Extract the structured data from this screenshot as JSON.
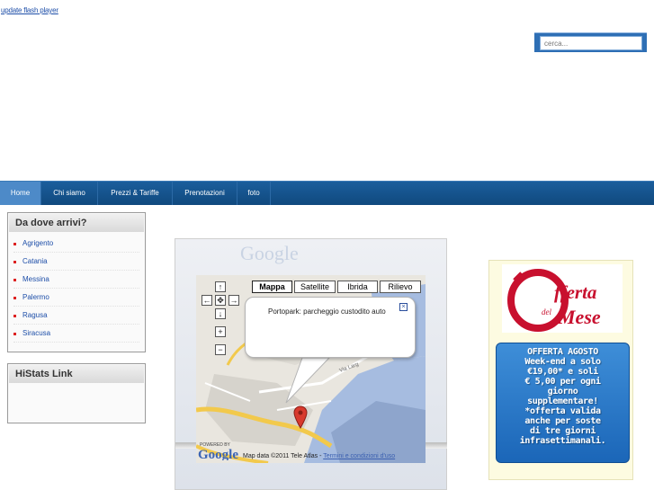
{
  "header": {
    "flash_link": "update flash player",
    "search_placeholder": "cerca..."
  },
  "nav": {
    "items": [
      {
        "label": "Home",
        "active": true
      },
      {
        "label": "Chi siamo",
        "active": false
      },
      {
        "label": "Prezzi & Tariffe",
        "active": false
      },
      {
        "label": "Prenotazioni",
        "active": false
      },
      {
        "label": "foto",
        "active": false
      }
    ]
  },
  "sidebar": {
    "arrivals_title": "Da dove arrivi?",
    "cities": [
      "Agrigento",
      "Catania",
      "Messina",
      "Palermo",
      "Ragusa",
      "Siracusa"
    ],
    "histats_title": "HiStats Link"
  },
  "map": {
    "types": [
      "Mappa",
      "Satellite",
      "Ibrida",
      "Rilievo"
    ],
    "active_type": "Mappa",
    "pan_icons": [
      "pan-up-icon",
      "pan-left-icon",
      "pan-center-icon",
      "pan-right-icon",
      "pan-down-icon"
    ],
    "info_text": "Portopark: parcheggio custodito auto",
    "attribution": "Map data ©2011 Tele Atlas - ",
    "terms_link": "Termini e condizioni d'uso",
    "powered_by": "POWERED BY",
    "google_word": "Google",
    "street_label": "Via Larg",
    "colors": {
      "road_yellow": "#f2c94c",
      "water": "#a6bce0",
      "land": "#e9e6df",
      "marker": "#d83a2e"
    }
  },
  "promo": {
    "logo_offerta": "fferta",
    "logo_del": "del",
    "logo_mese": "Mese",
    "offer_lines": [
      "OFFERTA AGOSTO",
      "Week-end a solo",
      "€19,00* e soli",
      "€ 5,00 per ogni",
      "giorno",
      "supplementare!",
      "*offerta valida",
      "anche per soste",
      "di tre giorni",
      "infrasettimanali."
    ],
    "colors": {
      "accent_red": "#c8102e",
      "offer_blue": "#2a78c8"
    }
  }
}
